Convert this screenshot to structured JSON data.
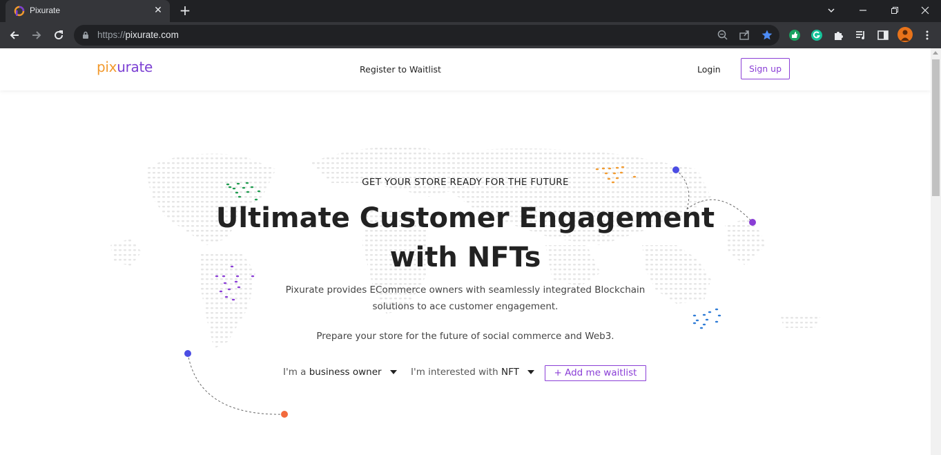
{
  "browser": {
    "tab_title": "Pixurate",
    "url_scheme": "https://",
    "url_host": "pixurate.com"
  },
  "header": {
    "logo_pre": "pi",
    "logo_post": "urate",
    "register_link": "Register to Waitlist",
    "login_link": "Login",
    "signup_button": "Sign up"
  },
  "hero": {
    "eyebrow": "GET YOUR STORE READY FOR THE FUTURE",
    "headline_line1": "Ultimate Customer Engagement",
    "headline_line2": "with NFTs",
    "description_line1": "Pixurate provides ECommerce owners with seamlessly integrated Blockchain",
    "description_line2": "solutions to ace customer engagement.",
    "description2": "Prepare your store for the future of social commerce and Web3."
  },
  "form": {
    "role_prefix": "I'm a",
    "role_value": "business owner",
    "interest_prefix": "I'm interested with",
    "interest_value": "NFT",
    "waitlist_button": "+ Add me waitlist"
  },
  "colors": {
    "accent": "#8a3ed6",
    "logo_orange": "#f29a2e",
    "logo_purple": "#7b3fd3"
  }
}
